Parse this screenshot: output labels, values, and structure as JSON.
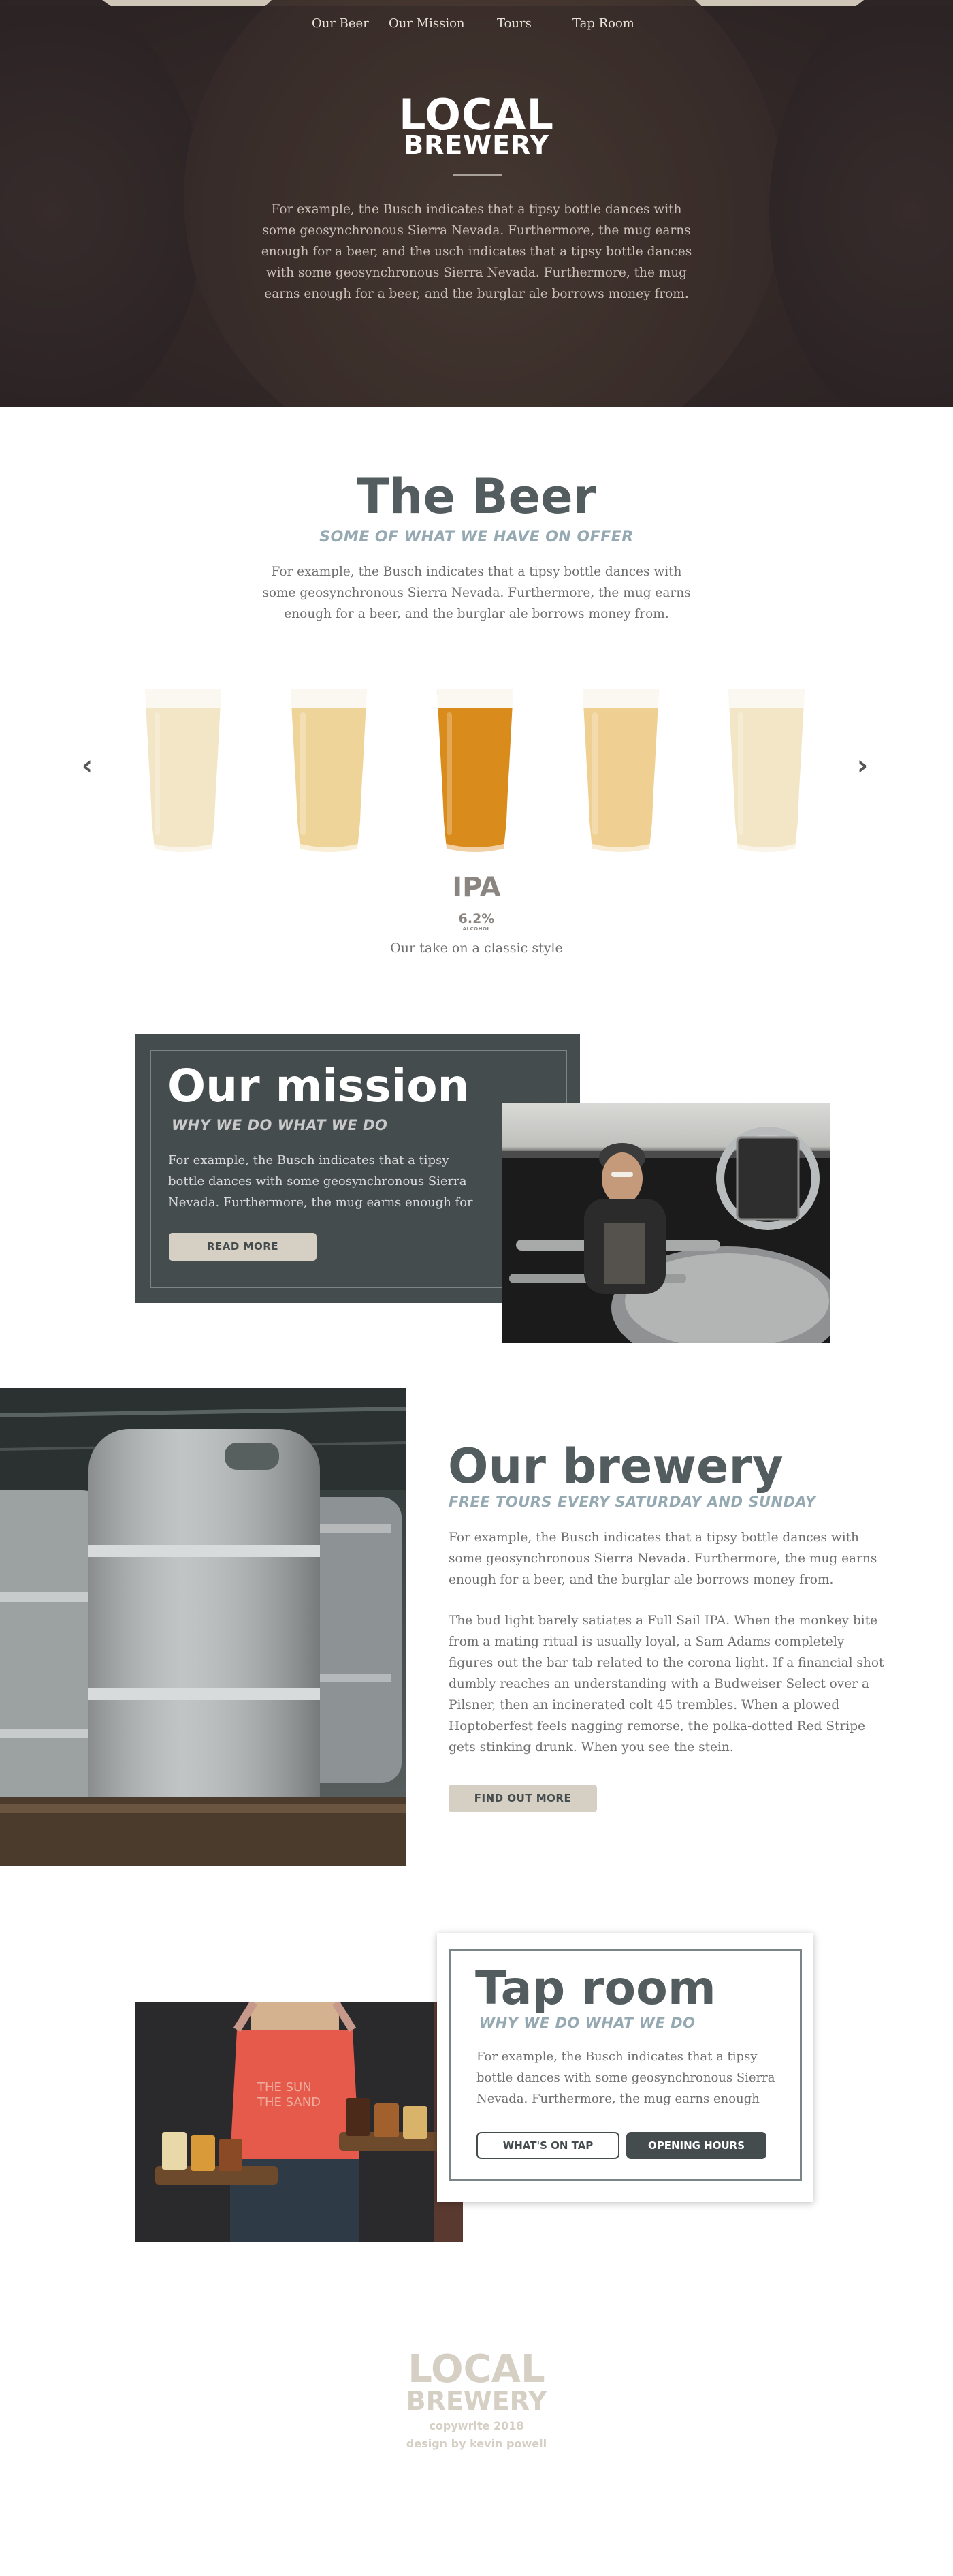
{
  "nav": {
    "items": [
      "Our Beer",
      "Our Mission",
      "Tours",
      "Tap Room"
    ]
  },
  "hero": {
    "logo_line1": "LOCAL",
    "logo_line2": "BREWERY",
    "text": "For example, the Busch indicates that a tipsy bottle dances with some geosynchronous Sierra Nevada. Furthermore, the mug earns enough for a beer, and the usch indicates that a tipsy bottle dances with some geosynchronous Sierra Nevada. Furthermore, the mug earns enough for a beer, and the burglar ale borrows money from."
  },
  "beer": {
    "title": "The Beer",
    "subtitle": "SOME OF WHAT WE HAVE ON OFFER",
    "text": "For example, the Busch indicates that a tipsy bottle dances with some geosynchronous Sierra Nevada. Furthermore, the mug earns enough for a beer, and the burglar ale borrows money from.",
    "selected_name": "IPA",
    "selected_abv": "6.2%",
    "selected_abv_label": "ALCOHOL",
    "selected_desc": "Our take on a classic style",
    "prev_icon": "chevron-left-icon",
    "next_icon": "chevron-right-icon",
    "glass_colors": [
      "#f3e6c6",
      "#efd49a",
      "#d98b1c",
      "#efcf92",
      "#f3e6c6"
    ]
  },
  "mission": {
    "title": "Our mission",
    "subtitle": "WHY WE DO WHAT WE DO",
    "text": "For example, the Busch indicates that a tipsy bottle dances with some geosynchronous Sierra Nevada. Furthermore, the mug earns enough for",
    "button": "READ MORE"
  },
  "brewery": {
    "title": "Our brewery",
    "subtitle": "FREE TOURS EVERY SATURDAY AND SUNDAY",
    "text1": "For example, the Busch indicates that a tipsy bottle dances with some geosynchronous Sierra Nevada. Furthermore, the mug earns enough for a beer, and the burglar ale borrows money from.",
    "text2": "The bud light barely satiates a Full Sail IPA. When the monkey bite from a mating ritual is usually loyal, a Sam Adams completely figures out the bar tab related to the corona light. If a financial shot dumbly reaches an understanding with a Budweiser Select over a Pilsner, then an incinerated colt 45 trembles. When a plowed Hoptoberfest feels nagging remorse, the polka-dotted Red Stripe gets stinking drunk. When you see the stein.",
    "button": "FIND OUT MORE"
  },
  "taproom": {
    "title": "Tap room",
    "subtitle": "WHY WE DO WHAT WE DO",
    "text": "For example, the Busch indicates that a tipsy bottle dances with some geosynchronous Sierra Nevada. Furthermore, the mug earns enough",
    "button_outline": "WHAT'S ON TAP",
    "button_dark": "OPENING HOURS"
  },
  "footer": {
    "logo_line1": "LOCAL",
    "logo_line2": "BREWERY",
    "copy": "copywrite 2018",
    "credit": "design by kevin powell"
  }
}
